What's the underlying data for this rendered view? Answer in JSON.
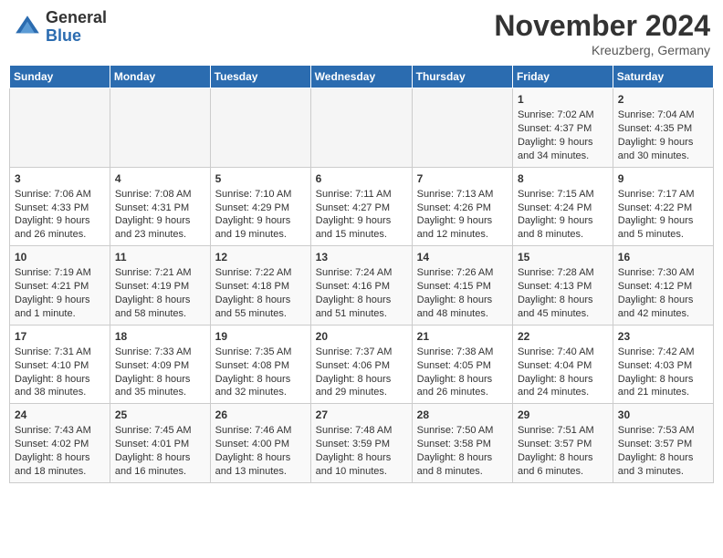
{
  "header": {
    "logo_line1": "General",
    "logo_line2": "Blue",
    "month": "November 2024",
    "location": "Kreuzberg, Germany"
  },
  "days_of_week": [
    "Sunday",
    "Monday",
    "Tuesday",
    "Wednesday",
    "Thursday",
    "Friday",
    "Saturday"
  ],
  "weeks": [
    [
      {
        "day": "",
        "info": ""
      },
      {
        "day": "",
        "info": ""
      },
      {
        "day": "",
        "info": ""
      },
      {
        "day": "",
        "info": ""
      },
      {
        "day": "",
        "info": ""
      },
      {
        "day": "1",
        "info": "Sunrise: 7:02 AM\nSunset: 4:37 PM\nDaylight: 9 hours and 34 minutes."
      },
      {
        "day": "2",
        "info": "Sunrise: 7:04 AM\nSunset: 4:35 PM\nDaylight: 9 hours and 30 minutes."
      }
    ],
    [
      {
        "day": "3",
        "info": "Sunrise: 7:06 AM\nSunset: 4:33 PM\nDaylight: 9 hours and 26 minutes."
      },
      {
        "day": "4",
        "info": "Sunrise: 7:08 AM\nSunset: 4:31 PM\nDaylight: 9 hours and 23 minutes."
      },
      {
        "day": "5",
        "info": "Sunrise: 7:10 AM\nSunset: 4:29 PM\nDaylight: 9 hours and 19 minutes."
      },
      {
        "day": "6",
        "info": "Sunrise: 7:11 AM\nSunset: 4:27 PM\nDaylight: 9 hours and 15 minutes."
      },
      {
        "day": "7",
        "info": "Sunrise: 7:13 AM\nSunset: 4:26 PM\nDaylight: 9 hours and 12 minutes."
      },
      {
        "day": "8",
        "info": "Sunrise: 7:15 AM\nSunset: 4:24 PM\nDaylight: 9 hours and 8 minutes."
      },
      {
        "day": "9",
        "info": "Sunrise: 7:17 AM\nSunset: 4:22 PM\nDaylight: 9 hours and 5 minutes."
      }
    ],
    [
      {
        "day": "10",
        "info": "Sunrise: 7:19 AM\nSunset: 4:21 PM\nDaylight: 9 hours and 1 minute."
      },
      {
        "day": "11",
        "info": "Sunrise: 7:21 AM\nSunset: 4:19 PM\nDaylight: 8 hours and 58 minutes."
      },
      {
        "day": "12",
        "info": "Sunrise: 7:22 AM\nSunset: 4:18 PM\nDaylight: 8 hours and 55 minutes."
      },
      {
        "day": "13",
        "info": "Sunrise: 7:24 AM\nSunset: 4:16 PM\nDaylight: 8 hours and 51 minutes."
      },
      {
        "day": "14",
        "info": "Sunrise: 7:26 AM\nSunset: 4:15 PM\nDaylight: 8 hours and 48 minutes."
      },
      {
        "day": "15",
        "info": "Sunrise: 7:28 AM\nSunset: 4:13 PM\nDaylight: 8 hours and 45 minutes."
      },
      {
        "day": "16",
        "info": "Sunrise: 7:30 AM\nSunset: 4:12 PM\nDaylight: 8 hours and 42 minutes."
      }
    ],
    [
      {
        "day": "17",
        "info": "Sunrise: 7:31 AM\nSunset: 4:10 PM\nDaylight: 8 hours and 38 minutes."
      },
      {
        "day": "18",
        "info": "Sunrise: 7:33 AM\nSunset: 4:09 PM\nDaylight: 8 hours and 35 minutes."
      },
      {
        "day": "19",
        "info": "Sunrise: 7:35 AM\nSunset: 4:08 PM\nDaylight: 8 hours and 32 minutes."
      },
      {
        "day": "20",
        "info": "Sunrise: 7:37 AM\nSunset: 4:06 PM\nDaylight: 8 hours and 29 minutes."
      },
      {
        "day": "21",
        "info": "Sunrise: 7:38 AM\nSunset: 4:05 PM\nDaylight: 8 hours and 26 minutes."
      },
      {
        "day": "22",
        "info": "Sunrise: 7:40 AM\nSunset: 4:04 PM\nDaylight: 8 hours and 24 minutes."
      },
      {
        "day": "23",
        "info": "Sunrise: 7:42 AM\nSunset: 4:03 PM\nDaylight: 8 hours and 21 minutes."
      }
    ],
    [
      {
        "day": "24",
        "info": "Sunrise: 7:43 AM\nSunset: 4:02 PM\nDaylight: 8 hours and 18 minutes."
      },
      {
        "day": "25",
        "info": "Sunrise: 7:45 AM\nSunset: 4:01 PM\nDaylight: 8 hours and 16 minutes."
      },
      {
        "day": "26",
        "info": "Sunrise: 7:46 AM\nSunset: 4:00 PM\nDaylight: 8 hours and 13 minutes."
      },
      {
        "day": "27",
        "info": "Sunrise: 7:48 AM\nSunset: 3:59 PM\nDaylight: 8 hours and 10 minutes."
      },
      {
        "day": "28",
        "info": "Sunrise: 7:50 AM\nSunset: 3:58 PM\nDaylight: 8 hours and 8 minutes."
      },
      {
        "day": "29",
        "info": "Sunrise: 7:51 AM\nSunset: 3:57 PM\nDaylight: 8 hours and 6 minutes."
      },
      {
        "day": "30",
        "info": "Sunrise: 7:53 AM\nSunset: 3:57 PM\nDaylight: 8 hours and 3 minutes."
      }
    ]
  ]
}
